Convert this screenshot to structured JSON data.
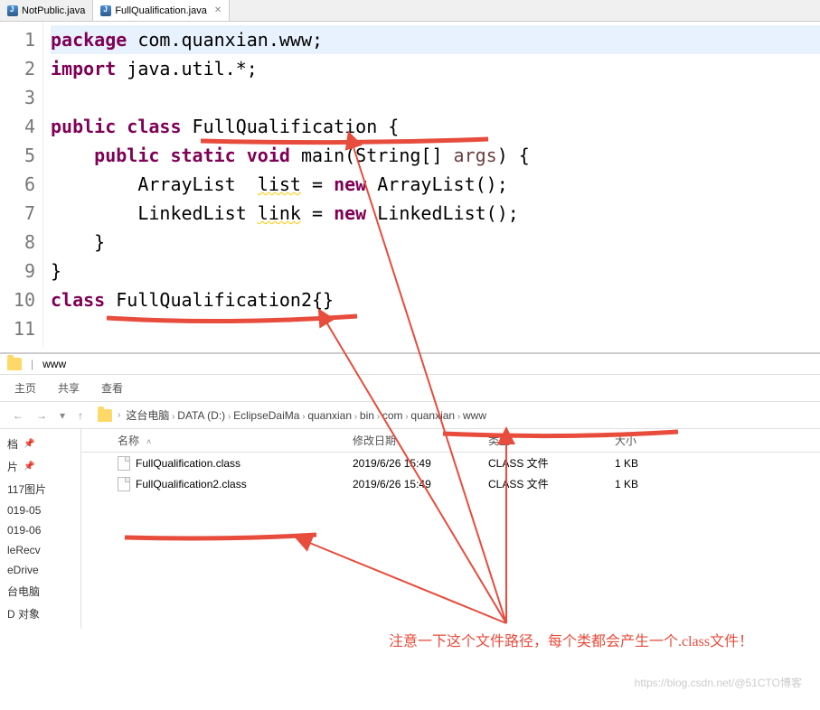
{
  "tabs": [
    {
      "label": "NotPublic.java",
      "active": false
    },
    {
      "label": "FullQualification.java",
      "active": true
    }
  ],
  "code": {
    "lines": [
      {
        "n": "1",
        "hl": true,
        "tokens": [
          {
            "t": "package",
            "c": "kw"
          },
          {
            "t": " com.quanxian.www;",
            "c": "id"
          }
        ]
      },
      {
        "n": "2",
        "tokens": [
          {
            "t": "import",
            "c": "kw"
          },
          {
            "t": " java.util.*;",
            "c": "id"
          }
        ]
      },
      {
        "n": "3",
        "tokens": []
      },
      {
        "n": "4",
        "tokens": [
          {
            "t": "public class ",
            "c": "kw"
          },
          {
            "t": "FullQualification",
            "c": "id under"
          },
          {
            "t": " {",
            "c": "id"
          }
        ]
      },
      {
        "n": "5",
        "warn": true,
        "tokens": [
          {
            "t": "    ",
            "c": ""
          },
          {
            "t": "public static void",
            "c": "kw"
          },
          {
            "t": " main(String[] ",
            "c": "id"
          },
          {
            "t": "args",
            "c": "arg"
          },
          {
            "t": ") {",
            "c": "id"
          }
        ]
      },
      {
        "n": "6",
        "warn": true,
        "tokens": [
          {
            "t": "        ArrayList  ",
            "c": "id"
          },
          {
            "t": "list",
            "c": "wavy"
          },
          {
            "t": " = ",
            "c": "id"
          },
          {
            "t": "new",
            "c": "kw"
          },
          {
            "t": " ArrayList();",
            "c": "id"
          }
        ]
      },
      {
        "n": "7",
        "warn": true,
        "tokens": [
          {
            "t": "        LinkedList ",
            "c": "id"
          },
          {
            "t": "link",
            "c": "wavy"
          },
          {
            "t": " = ",
            "c": "id"
          },
          {
            "t": "new",
            "c": "kw"
          },
          {
            "t": " LinkedList();",
            "c": "id"
          }
        ]
      },
      {
        "n": "8",
        "tokens": [
          {
            "t": "    }",
            "c": "id"
          }
        ]
      },
      {
        "n": "9",
        "tokens": [
          {
            "t": "}",
            "c": "id"
          }
        ]
      },
      {
        "n": "10",
        "tokens": [
          {
            "t": "class ",
            "c": "kw"
          },
          {
            "t": "FullQualification2",
            "c": "id under"
          },
          {
            "t": "{}",
            "c": "id"
          }
        ]
      },
      {
        "n": "11",
        "tokens": []
      }
    ]
  },
  "explorer": {
    "title": "www",
    "ribbon": [
      "主页",
      "共享",
      "查看"
    ],
    "breadcrumb": [
      "这台电脑",
      "DATA (D:)",
      "EclipseDaiMa",
      "quanxian",
      "bin",
      "com",
      "quanxian",
      "www"
    ],
    "sidebar": [
      "档",
      "片",
      "117图片",
      "019-05",
      "019-06",
      "leRecv",
      "eDrive",
      "台电脑",
      "D 对象"
    ],
    "sidebar_pinned": [
      0,
      1
    ],
    "columns": {
      "name": "名称",
      "date": "修改日期",
      "type": "类型",
      "size": "大小"
    },
    "files": [
      {
        "name": "FullQualification.class",
        "date": "2019/6/26 15:49",
        "type": "CLASS 文件",
        "size": "1 KB"
      },
      {
        "name": "FullQualification2.class",
        "date": "2019/6/26 15:49",
        "type": "CLASS 文件",
        "size": "1 KB"
      }
    ]
  },
  "annotation": "注意一下这个文件路径，每个类都会产生一个.class文件！",
  "watermark": "https://blog.csdn.net/@51CTO博客"
}
